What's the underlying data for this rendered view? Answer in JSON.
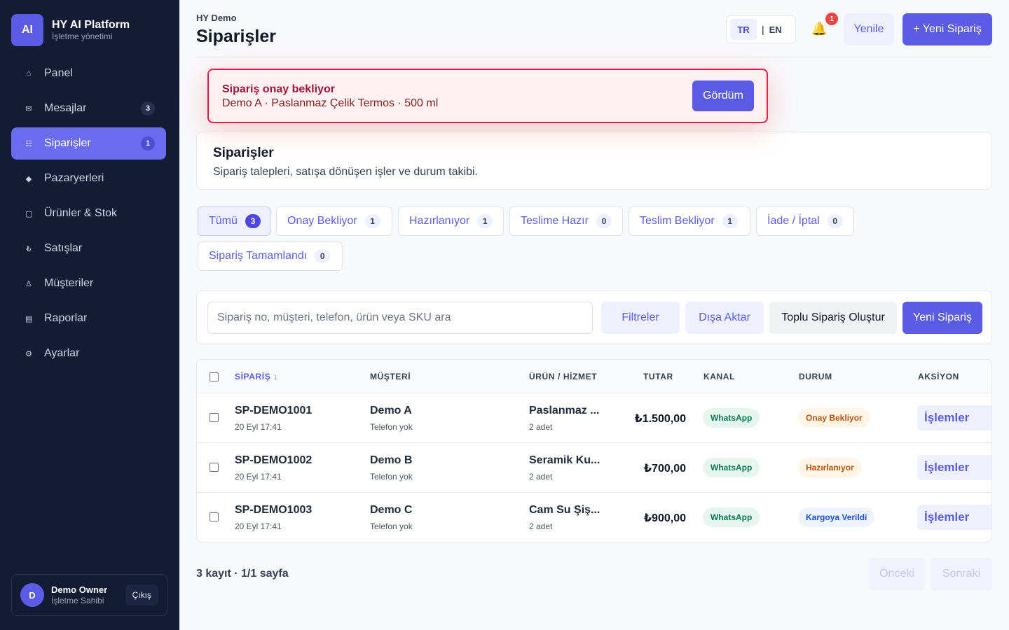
{
  "sidebar": {
    "brand": {
      "logo": "AI",
      "title": "HY AI Platform",
      "subtitle": "İşletme yönetimi"
    },
    "items": [
      {
        "label": "Panel",
        "icon": "home-icon",
        "glyph": "⌂",
        "badge": ""
      },
      {
        "label": "Mesajlar",
        "icon": "mail-icon",
        "glyph": "✉",
        "badge": "3"
      },
      {
        "label": "Siparişler",
        "icon": "list-icon",
        "glyph": "☷",
        "badge": "1",
        "active": true
      },
      {
        "label": "Pazaryerleri",
        "icon": "diamond-icon",
        "glyph": "◆",
        "badge": ""
      },
      {
        "label": "Ürünler & Stok",
        "icon": "box-icon",
        "glyph": "▢",
        "badge": ""
      },
      {
        "label": "Satışlar",
        "icon": "lira-icon",
        "glyph": "₺",
        "badge": ""
      },
      {
        "label": "Müşteriler",
        "icon": "person-icon",
        "glyph": "♙",
        "badge": ""
      },
      {
        "label": "Raporlar",
        "icon": "report-icon",
        "glyph": "▤",
        "badge": ""
      },
      {
        "label": "Ayarlar",
        "icon": "gear-icon",
        "glyph": "⚙",
        "badge": ""
      }
    ],
    "user": {
      "initial": "D",
      "name": "Demo Owner",
      "role": "İşletme Sahibi",
      "logout": "Çıkış"
    }
  },
  "header": {
    "breadcrumb": "HY Demo",
    "title": "Siparişler",
    "lang_tr": "TR",
    "lang_sep": "|",
    "lang_en": "EN",
    "bell_glyph": "🔔",
    "notification_count": "1",
    "refresh_label": "Yenile",
    "new_order_label": "+ Yeni Sipariş"
  },
  "alert": {
    "title": "Sipariş onay bekliyor",
    "message": "Demo A · Paslanmaz Çelik Termos · 500 ml",
    "button": "Gördüm"
  },
  "section": {
    "title": "Siparişler",
    "subtitle": "Sipariş talepleri, satışa dönüşen işler ve durum takibi."
  },
  "tabs": [
    {
      "label": "Tümü",
      "count": "3",
      "active": true
    },
    {
      "label": "Onay Bekliyor",
      "count": "1"
    },
    {
      "label": "Hazırlanıyor",
      "count": "1"
    },
    {
      "label": "Teslime Hazır",
      "count": "0"
    },
    {
      "label": "Teslim Bekliyor",
      "count": "1"
    },
    {
      "label": "İade / İptal",
      "count": "0"
    },
    {
      "label": "Sipariş Tamamlandı",
      "count": "0"
    }
  ],
  "toolbar": {
    "search_placeholder": "Sipariş no, müşteri, telefon, ürün veya SKU ara",
    "filters": "Filtreler",
    "export": "Dışa Aktar",
    "bulk": "Toplu Sipariş Oluştur",
    "new": "Yeni Sipariş"
  },
  "table": {
    "columns": {
      "order": "SİPARİŞ ↓",
      "customer": "MÜŞTERİ",
      "product": "ÜRÜN / HİZMET",
      "amount": "TUTAR",
      "channel": "KANAL",
      "status": "DURUM",
      "action": "AKSİYON"
    },
    "rows": [
      {
        "id": "SP-DEMO1001",
        "date": "20 Eyl 17:41",
        "customer": "Demo A",
        "phone": "Telefon yok",
        "product": "Paslanmaz ...",
        "qty": "2 adet",
        "amount": "₺1.500,00",
        "channel": "WhatsApp",
        "status": "Onay Bekliyor",
        "status_class": "st-wait",
        "action": "İşlemler"
      },
      {
        "id": "SP-DEMO1002",
        "date": "20 Eyl 17:41",
        "customer": "Demo B",
        "phone": "Telefon yok",
        "product": "Seramik Ku...",
        "qty": "2 adet",
        "amount": "₺700,00",
        "channel": "WhatsApp",
        "status": "Hazırlanıyor",
        "status_class": "st-prep",
        "action": "İşlemler"
      },
      {
        "id": "SP-DEMO1003",
        "date": "20 Eyl 17:41",
        "customer": "Demo C",
        "phone": "Telefon yok",
        "product": "Cam Su Şiş...",
        "qty": "2 adet",
        "amount": "₺900,00",
        "channel": "WhatsApp",
        "status": "Kargoya Verildi",
        "status_class": "st-ship",
        "action": "İşlemler"
      }
    ]
  },
  "pager": {
    "info": "3 kayıt · 1/1 sayfa",
    "prev": "Önceki",
    "next": "Sonraki"
  },
  "colors": {
    "accent": "#5b5ce6",
    "sidebar": "#131b35",
    "alert_border": "#e11d48",
    "whatsapp": "#047857"
  }
}
